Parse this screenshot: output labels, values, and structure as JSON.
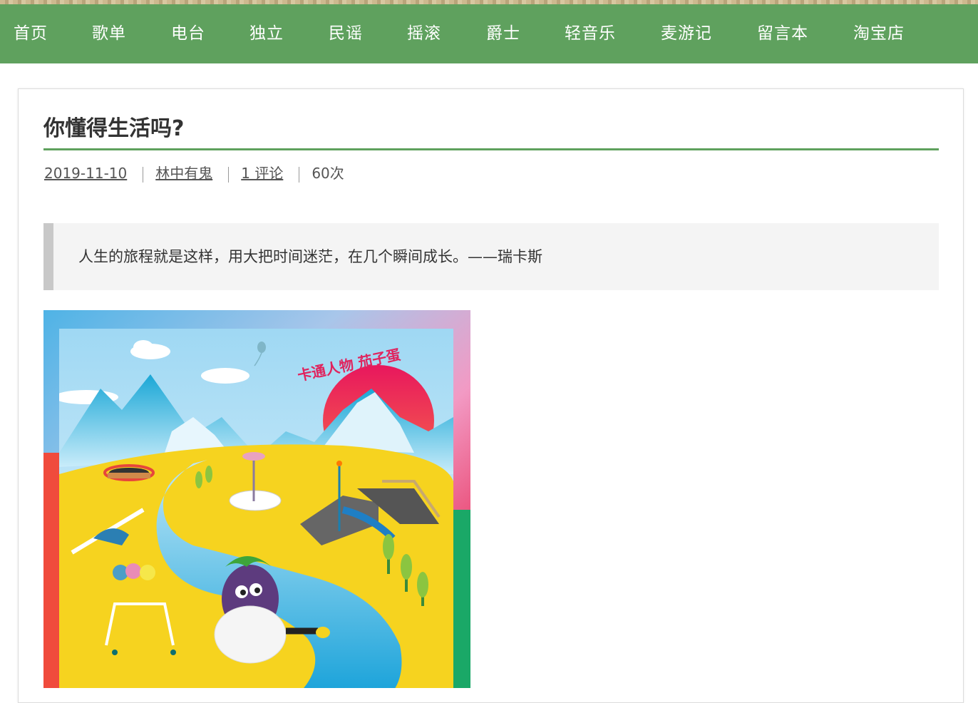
{
  "nav": {
    "items": [
      {
        "label": "首页"
      },
      {
        "label": "歌单"
      },
      {
        "label": "电台"
      },
      {
        "label": "独立"
      },
      {
        "label": "民谣"
      },
      {
        "label": "摇滚"
      },
      {
        "label": "爵士"
      },
      {
        "label": "轻音乐"
      },
      {
        "label": "麦游记"
      },
      {
        "label": "留言本"
      },
      {
        "label": "淘宝店"
      }
    ]
  },
  "post": {
    "title": "你懂得生活吗?",
    "date": "2019-11-10",
    "author": "林中有鬼",
    "comments": "1 评论",
    "views": "60次",
    "quote": "人生的旅程就是这样，用大把时间迷茫，在几个瞬间成长。——瑞卡斯",
    "image_caption": "卡通人物 茄子蛋"
  },
  "colors": {
    "nav_bg": "#5fa15e",
    "accent": "#5fa15e"
  }
}
